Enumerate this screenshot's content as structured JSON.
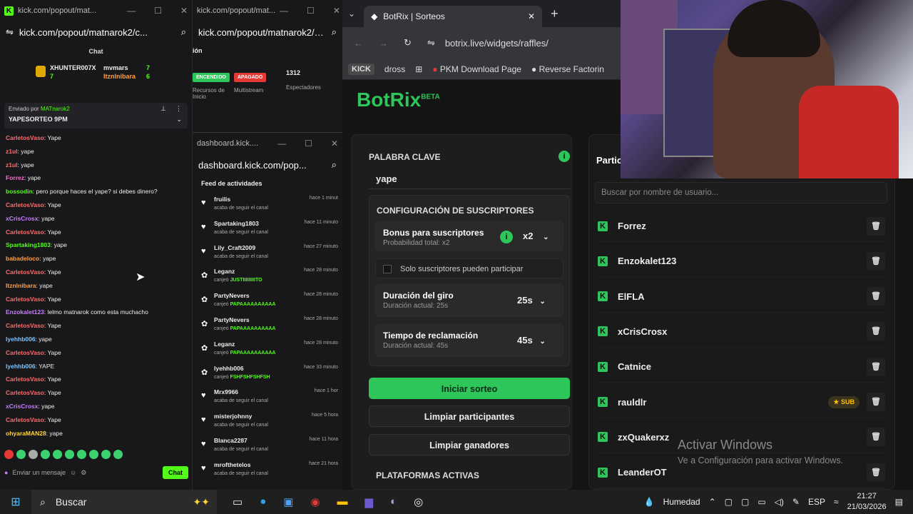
{
  "w1": {
    "title": "kick.com/popout/mat...",
    "url": "kick.com/popout/matnarok2/c...",
    "header": "Chat",
    "leaders": [
      {
        "name": "XHUNTER007X",
        "count": "7"
      },
      {
        "name": "mvmars",
        "count": "7"
      },
      {
        "name": "Itznlnibara",
        "count": "6"
      }
    ],
    "pinned_by_label": "Enviado por",
    "pinned_by": "MATnarok2",
    "pinned_msg": "YAPESORTEO 9PM",
    "messages": [
      {
        "user": "CarletosVaso",
        "text": ": Yape",
        "color": "#ff6b6b"
      },
      {
        "user": "z1ul",
        "text": ": yape",
        "color": "#ff6b6b"
      },
      {
        "user": "z1ul",
        "text": ": yape",
        "color": "#ff6b6b"
      },
      {
        "user": "Forrez",
        "text": ": yape",
        "color": "#ff6bd5"
      },
      {
        "user": "bossodin",
        "text": ": pero porque haces el yape? si debes dinero?",
        "color": "#53fc18"
      },
      {
        "user": "CarletosVaso",
        "text": ": Yape",
        "color": "#ff6b6b"
      },
      {
        "user": "xCrisCrosx",
        "text": ": yape",
        "color": "#c77dff"
      },
      {
        "user": "CarletosVaso",
        "text": ": Yape",
        "color": "#ff6b6b"
      },
      {
        "user": "Spartaking1803",
        "text": ": yape",
        "color": "#53fc18"
      },
      {
        "user": "babadeloco",
        "text": ": yape",
        "color": "#ff9f43"
      },
      {
        "user": "CarletosVaso",
        "text": ": Yape",
        "color": "#ff6b6b"
      },
      {
        "user": "Itznlnibara",
        "text": ": yape",
        "color": "#ff9f43"
      },
      {
        "user": "CarletosVaso",
        "text": ": Yape",
        "color": "#ff6b6b"
      },
      {
        "user": "Enzokalet123",
        "text": ": lelmo matnarok como esta muchacho",
        "color": "#c77dff"
      },
      {
        "user": "CarletosVaso",
        "text": ": Yape",
        "color": "#ff6b6b"
      },
      {
        "user": "lyehhb006",
        "text": ": yape",
        "color": "#7cc4ff"
      },
      {
        "user": "CarletosVaso",
        "text": ": Yape",
        "color": "#ff6b6b"
      },
      {
        "user": "lyehhb006",
        "text": ": YAPE",
        "color": "#7cc4ff"
      },
      {
        "user": "CarletosVaso",
        "text": ": Yape",
        "color": "#ff6b6b"
      },
      {
        "user": "CarletosVaso",
        "text": ": Yape",
        "color": "#ff6b6b"
      },
      {
        "user": "xCrisCrosx",
        "text": ": yape",
        "color": "#c77dff"
      },
      {
        "user": "CarletosVaso",
        "text": ": Yape",
        "color": "#ff6b6b"
      },
      {
        "user": "ohyaraMAN28",
        "text": ": yape",
        "color": "#ffd43b"
      }
    ],
    "input_placeholder": "Enviar un mensaje",
    "chat_button": "Chat"
  },
  "w2": {
    "title": "kick.com/popout/mat...",
    "url": "kick.com/popout/matnarok2/s...",
    "section": "ión",
    "tag1": "ENCENDIDO",
    "tag2": "APAGADO",
    "viewers": "1312",
    "col1": "Recursos de Inicio",
    "col2": "Multistream",
    "col3": "Espectadores"
  },
  "w3": {
    "title": "dashboard.kick....",
    "url": "dashboard.kick.com/pop...",
    "feed_title": "Feed de actividades",
    "items": [
      {
        "icon": "heart",
        "name": "fruilis",
        "desc": "acaba de seguir el canal",
        "hl": "",
        "time": "hace 1 minut"
      },
      {
        "icon": "heart",
        "name": "Spartaking1803",
        "desc": "acaba de seguir el canal",
        "hl": "",
        "time": "hace 11 minuto"
      },
      {
        "icon": "heart",
        "name": "Lily_Craft2009",
        "desc": "acaba de seguir el canal",
        "hl": "",
        "time": "hace 27 minuto"
      },
      {
        "icon": "redeem",
        "name": "Leganz",
        "desc": "canjeó ",
        "hl": "JUSTIIIIIIIIITO",
        "time": "hace 28 minuto"
      },
      {
        "icon": "redeem",
        "name": "PartyNevers",
        "desc": "canjeó ",
        "hl": "PAPAAAAAAAAAA",
        "time": "hace 28 minuto"
      },
      {
        "icon": "redeem",
        "name": "PartyNevers",
        "desc": "canjeó ",
        "hl": "PAPAAAAAAAAAA",
        "time": "hace 28 minuto"
      },
      {
        "icon": "redeem",
        "name": "Leganz",
        "desc": "canjeó ",
        "hl": "PAPAAAAAAAAAA",
        "time": "hace 28 minuto"
      },
      {
        "icon": "redeem",
        "name": "lyehhb006",
        "desc": "canjeó ",
        "hl": "FSHFSHFSHFSH",
        "time": "hace 33 minuto"
      },
      {
        "icon": "heart",
        "name": "Mrx9966",
        "desc": "acaba de seguir el canal",
        "hl": "",
        "time": "hace 1 hor"
      },
      {
        "icon": "heart",
        "name": "misterjohnny",
        "desc": "acaba de seguir el canal",
        "hl": "",
        "time": "hace 5 hora"
      },
      {
        "icon": "heart",
        "name": "Blanca2287",
        "desc": "acaba de seguir el canal",
        "hl": "",
        "time": "hace 11 hora"
      },
      {
        "icon": "heart",
        "name": "mrofthetelos",
        "desc": "acaba de seguir el canal",
        "hl": "",
        "time": "hace 21 hora"
      }
    ]
  },
  "w4": {
    "tab_title": "BotRix | Sorteos",
    "url": "botrix.live/widgets/raffles/",
    "bookmarks": [
      "KICK",
      "dross",
      "PKM Download Page",
      "Reverse Factorin"
    ],
    "logo": "BotRix",
    "logo_beta": "BETA",
    "keyword_label": "PALABRA CLAVE",
    "keyword": "yape",
    "subs_config": "CONFIGURACIÓN DE SUSCRIPTORES",
    "bonus_label": "Bonus para suscriptores",
    "bonus_sub": "Probabilidad total: x2",
    "bonus_value": "x2",
    "only_subs": "Solo suscriptores pueden participar",
    "spin_label": "Duración del giro",
    "spin_sub": "Duración actual: 25s",
    "spin_value": "25s",
    "claim_label": "Tiempo de reclamación",
    "claim_sub": "Duración actual: 45s",
    "claim_value": "45s",
    "start_btn": "Iniciar sorteo",
    "clear_part": "Limpiar participantes",
    "clear_win": "Limpiar ganadores",
    "platforms": "PLATAFORMAS ACTIVAS",
    "right_title": "Partic",
    "search_placeholder": "Buscar por nombre de usuario...",
    "participants": [
      {
        "name": "Forrez",
        "badge": ""
      },
      {
        "name": "Enzokalet123",
        "badge": ""
      },
      {
        "name": "ElFLA",
        "badge": ""
      },
      {
        "name": "xCrisCrosx",
        "badge": ""
      },
      {
        "name": "Catnice",
        "badge": ""
      },
      {
        "name": "rauldlr",
        "badge": "SUB"
      },
      {
        "name": "zxQuakerxz",
        "badge": ""
      },
      {
        "name": "LeanderOT",
        "badge": ""
      }
    ],
    "win_title": "Activar Windows",
    "win_sub": "Ve a Configuración para activar Windows."
  },
  "taskbar": {
    "search": "Buscar",
    "weather": "Humedad",
    "lang": "ESP",
    "time": "21:27",
    "date": "21/03/2026"
  },
  "colors": {
    "kick_green": "#53fc18",
    "botrix_green": "#2ec55a",
    "red": "#e53935"
  }
}
